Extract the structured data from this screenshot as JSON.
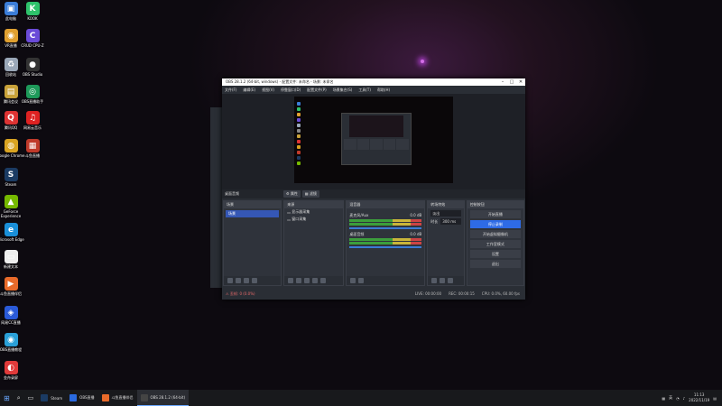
{
  "desktop": {
    "icons": [
      {
        "label": "此电脑",
        "color": "#3b7dd8",
        "glyph": "▣"
      },
      {
        "label": "KOOK",
        "color": "#2ec26b",
        "glyph": "K"
      },
      {
        "label": "VR直播",
        "color": "#e0a030",
        "glyph": "◉"
      },
      {
        "label": "CRUD CPU-Z",
        "color": "#6a4bd8",
        "glyph": "C"
      },
      {
        "label": "回收站",
        "color": "#9aa7b8",
        "glyph": "♻"
      },
      {
        "label": "OBS Studio",
        "color": "#333",
        "glyph": "●"
      },
      {
        "label": "腾讯会议",
        "color": "#c9a23a",
        "glyph": "▤"
      },
      {
        "label": "OBS直播助手",
        "color": "#1e9a5a",
        "glyph": "◎"
      },
      {
        "label": "腾讯QQ",
        "color": "#d33",
        "glyph": "Q"
      },
      {
        "label": "网易云音乐",
        "color": "#d22",
        "glyph": "♫"
      },
      {
        "label": "Google Chrome",
        "color": "#d9a321",
        "glyph": "◍"
      },
      {
        "label": "斗鱼直播",
        "color": "#c03a2a",
        "glyph": "▦"
      },
      {
        "label": "Steam",
        "color": "#1b3b63",
        "glyph": "S"
      },
      {
        "label": "GeForce Experience",
        "color": "#76b900",
        "glyph": "▲"
      },
      {
        "label": "Microsoft Edge",
        "color": "#1a8fd8",
        "glyph": "e"
      },
      {
        "label": "新建文本",
        "color": "#eee",
        "glyph": "▭"
      },
      {
        "label": "斗鱼直播伴侣",
        "color": "#e86a2a",
        "glyph": "▶"
      },
      {
        "label": "网易CC直播",
        "color": "#2a5ad8",
        "glyph": "◈"
      },
      {
        "label": "OBS直播教程",
        "color": "#2aa0d8",
        "glyph": "◉"
      },
      {
        "label": "金舟录屏",
        "color": "#e03a3a",
        "glyph": "◐"
      }
    ]
  },
  "obs": {
    "title": "OBS 28.1.2 (64-bit, windows) - 配置文件: 未命名 - 场景: 未命名",
    "menu": [
      "文件(F)",
      "编辑(E)",
      "视图(V)",
      "停靠窗口(D)",
      "配置文件(P)",
      "场景集合(S)",
      "工具(T)",
      "帮助(H)"
    ],
    "controls": {
      "source_label": "桌面音频",
      "props": "⚙ 属性",
      "filters": "▦ 滤镜"
    },
    "scenes": {
      "header": "场景",
      "items": [
        "场景"
      ]
    },
    "sources": {
      "header": "来源",
      "items": [
        "显示器采集",
        "窗口采集"
      ]
    },
    "mixer": {
      "header": "混音器",
      "tracks": [
        {
          "name": "麦克风/Aux",
          "db": "0.0 dB"
        },
        {
          "name": "桌面音频",
          "db": "0.0 dB"
        }
      ]
    },
    "transitions": {
      "header": "转场特效",
      "type": "淡出",
      "duration_label": "时长",
      "duration": "300 ms"
    },
    "controls_dock": {
      "header": "控制按钮",
      "buttons": [
        "开始直播",
        "停止录制",
        "开始虚拟摄像机",
        "工作室模式",
        "设置",
        "退出"
      ]
    },
    "status": {
      "warning": "⚠ 丢帧: 0 (0.0%)",
      "live": "LIVE: 00:00:00",
      "rec": "REC: 00:00:15",
      "cpu": "CPU: 0.0%, 60.00 fps"
    }
  },
  "taskbar": {
    "items": [
      {
        "label": "Steam",
        "color": "#1b3b63"
      },
      {
        "label": "OBS直播",
        "color": "#2a6ae0"
      },
      {
        "label": "斗鱼直播伴侣",
        "color": "#e86a2a"
      },
      {
        "label": "OBS 28.1.2 (64-bit)",
        "color": "#444"
      }
    ],
    "clock": {
      "time": "11:13",
      "date": "2022/11/19"
    },
    "lang": "英"
  }
}
